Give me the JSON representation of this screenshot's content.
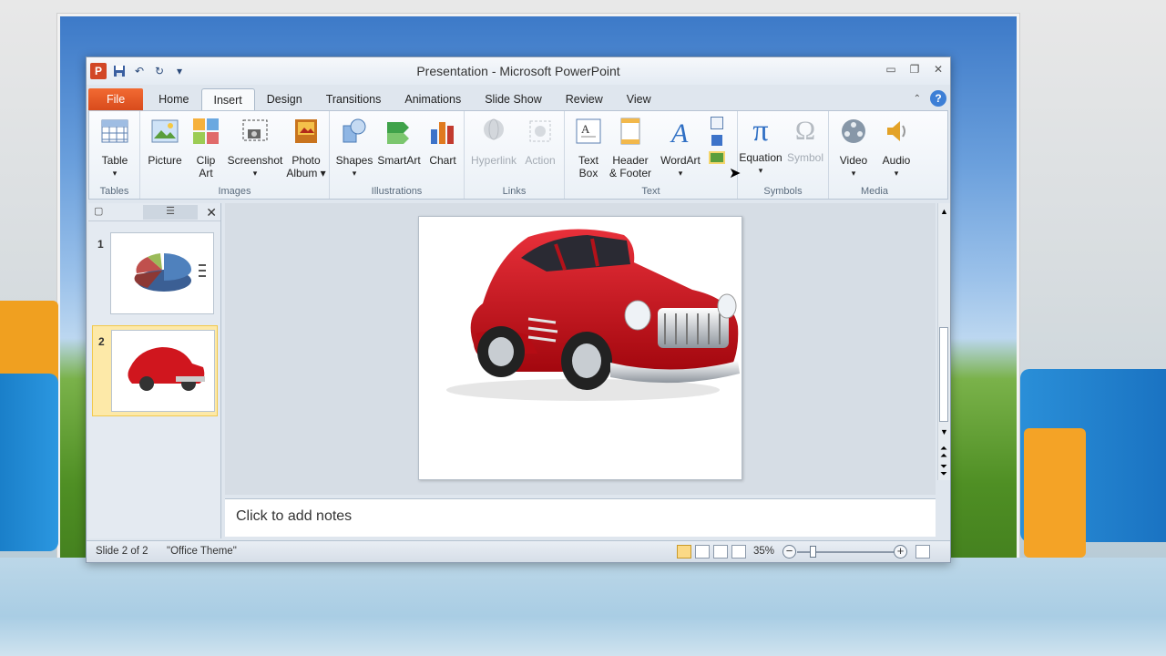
{
  "window": {
    "title": "Presentation  -  Microsoft PowerPoint"
  },
  "quick_access": {
    "save": "save-icon",
    "undo": "undo-icon",
    "redo": "redo-icon",
    "customize": "dropdown-icon"
  },
  "tabs": [
    "File",
    "Home",
    "Insert",
    "Design",
    "Transitions",
    "Animations",
    "Slide Show",
    "Review",
    "View"
  ],
  "active_tab": "Insert",
  "ribbon": {
    "groups": {
      "tables": "Tables",
      "images": "Images",
      "illustrations": "Illustrations",
      "links": "Links",
      "text": "Text",
      "symbols": "Symbols",
      "media": "Media"
    },
    "buttons": {
      "table": "Table",
      "picture": "Picture",
      "clip_art": "Clip Art",
      "clip": "Clip",
      "art": "Art",
      "screenshot": "Screenshot",
      "photo": "Photo",
      "album": "Album",
      "shapes": "Shapes",
      "smartart": "SmartArt",
      "chart": "Chart",
      "hyperlink": "Hyperlink",
      "action": "Action",
      "text": "Text",
      "box": "Box",
      "header": "Header",
      "footer": "& Footer",
      "wordart": "WordArt",
      "equation": "Equation",
      "symbol": "Symbol",
      "video": "Video",
      "audio": "Audio"
    }
  },
  "slides": [
    {
      "number": "1"
    },
    {
      "number": "2"
    }
  ],
  "selected_slide": "2",
  "notes": {
    "placeholder": "Click to add notes"
  },
  "status": {
    "slide": "Slide 2 of 2",
    "theme": "\"Office Theme\"",
    "zoom": "35%"
  },
  "colors": {
    "file_tab": "#d84b1c",
    "accent": "#3d7fd6",
    "car": "#d0161e"
  }
}
